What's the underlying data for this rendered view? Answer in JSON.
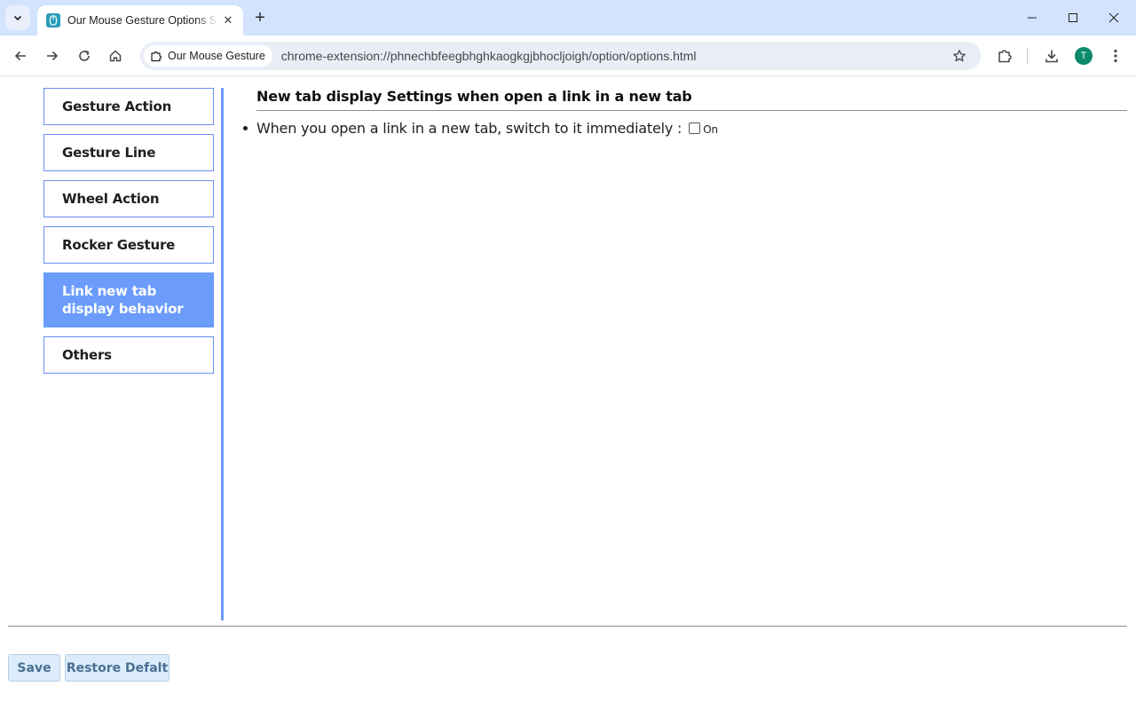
{
  "browser": {
    "tab": {
      "title": "Our Mouse Gesture Options Settings"
    },
    "omnibox": {
      "site_chip": "Our Mouse Gesture",
      "url": "chrome-extension://phnechbfeegbhghkaogkgjbhocljoigh/option/options.html"
    },
    "profile_initial": "T"
  },
  "sidebar": {
    "items": [
      {
        "label": "Gesture Action",
        "active": false
      },
      {
        "label": "Gesture Line",
        "active": false
      },
      {
        "label": "Wheel Action",
        "active": false
      },
      {
        "label": "Rocker Gesture",
        "active": false
      },
      {
        "label": "Link new tab display behavior",
        "active": true
      },
      {
        "label": "Others",
        "active": false
      }
    ]
  },
  "main": {
    "section_title": "New tab display Settings when open a link in a new tab",
    "options": [
      {
        "label": "When you open a link in a new tab, switch to it immediately :",
        "checkbox_label": "On",
        "checked": false
      }
    ]
  },
  "footer": {
    "save_label": "Save",
    "restore_label": "Restore Defalt"
  },
  "colors": {
    "accent": "#6b9cfc",
    "titlebar": "#d3e3fd",
    "button_bg": "#dcecfb",
    "button_text": "#4a6f93"
  }
}
